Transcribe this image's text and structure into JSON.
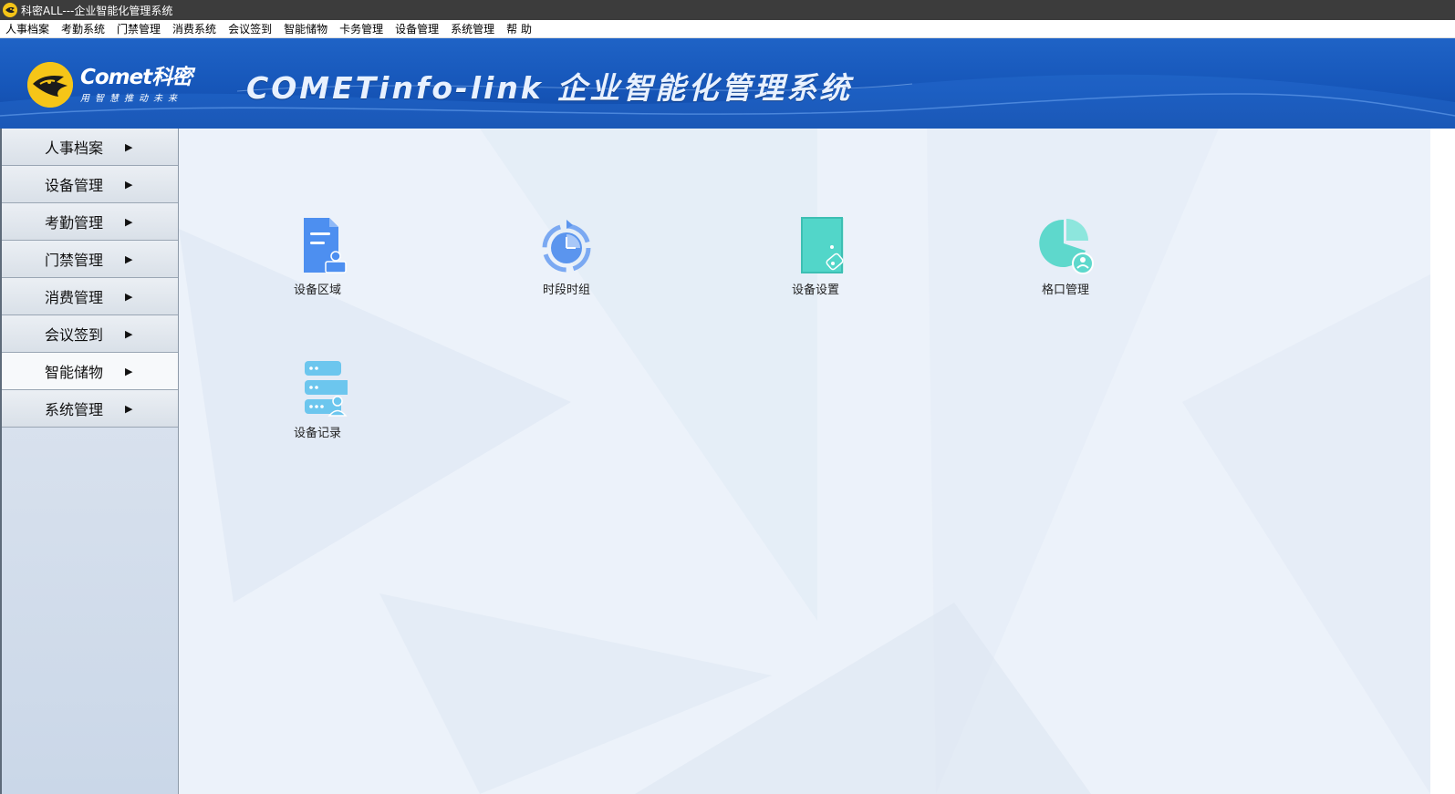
{
  "window": {
    "title": "科密ALL---企业智能化管理系统",
    "icon": "comet-logo-icon"
  },
  "menubar": {
    "items": [
      {
        "label": "人事档案"
      },
      {
        "label": "考勤系统"
      },
      {
        "label": "门禁管理"
      },
      {
        "label": "消费系统"
      },
      {
        "label": "会议签到"
      },
      {
        "label": "智能储物"
      },
      {
        "label": "卡务管理"
      },
      {
        "label": "设备管理"
      },
      {
        "label": "系统管理"
      },
      {
        "label": "帮 助"
      }
    ]
  },
  "banner": {
    "brand": "Comet科密",
    "slogan": "用智慧推动未来",
    "title": "COMETinfo-link  企业智能化管理系统",
    "colors": {
      "primary": "#1656b9",
      "logo": "#f5c518"
    }
  },
  "sidebar": {
    "active_index": 6,
    "arrow": "▶",
    "items": [
      {
        "label": "人事档案"
      },
      {
        "label": "设备管理"
      },
      {
        "label": "考勤管理"
      },
      {
        "label": "门禁管理"
      },
      {
        "label": "消费管理"
      },
      {
        "label": "会议签到"
      },
      {
        "label": "智能储物"
      },
      {
        "label": "系统管理"
      }
    ]
  },
  "main": {
    "tiles": [
      {
        "label": "设备区域",
        "icon": "document-user-icon",
        "color": "#4d8ff0"
      },
      {
        "label": "时段时组",
        "icon": "clock-cycle-icon",
        "color": "#5b95ee"
      },
      {
        "label": "设备设置",
        "icon": "door-settings-icon",
        "color": "#52d6c9"
      },
      {
        "label": "格口管理",
        "icon": "pie-chart-user-icon",
        "color": "#5ed8cc"
      },
      {
        "label": "设备记录",
        "icon": "server-user-icon",
        "color": "#6cc6ee"
      }
    ]
  }
}
